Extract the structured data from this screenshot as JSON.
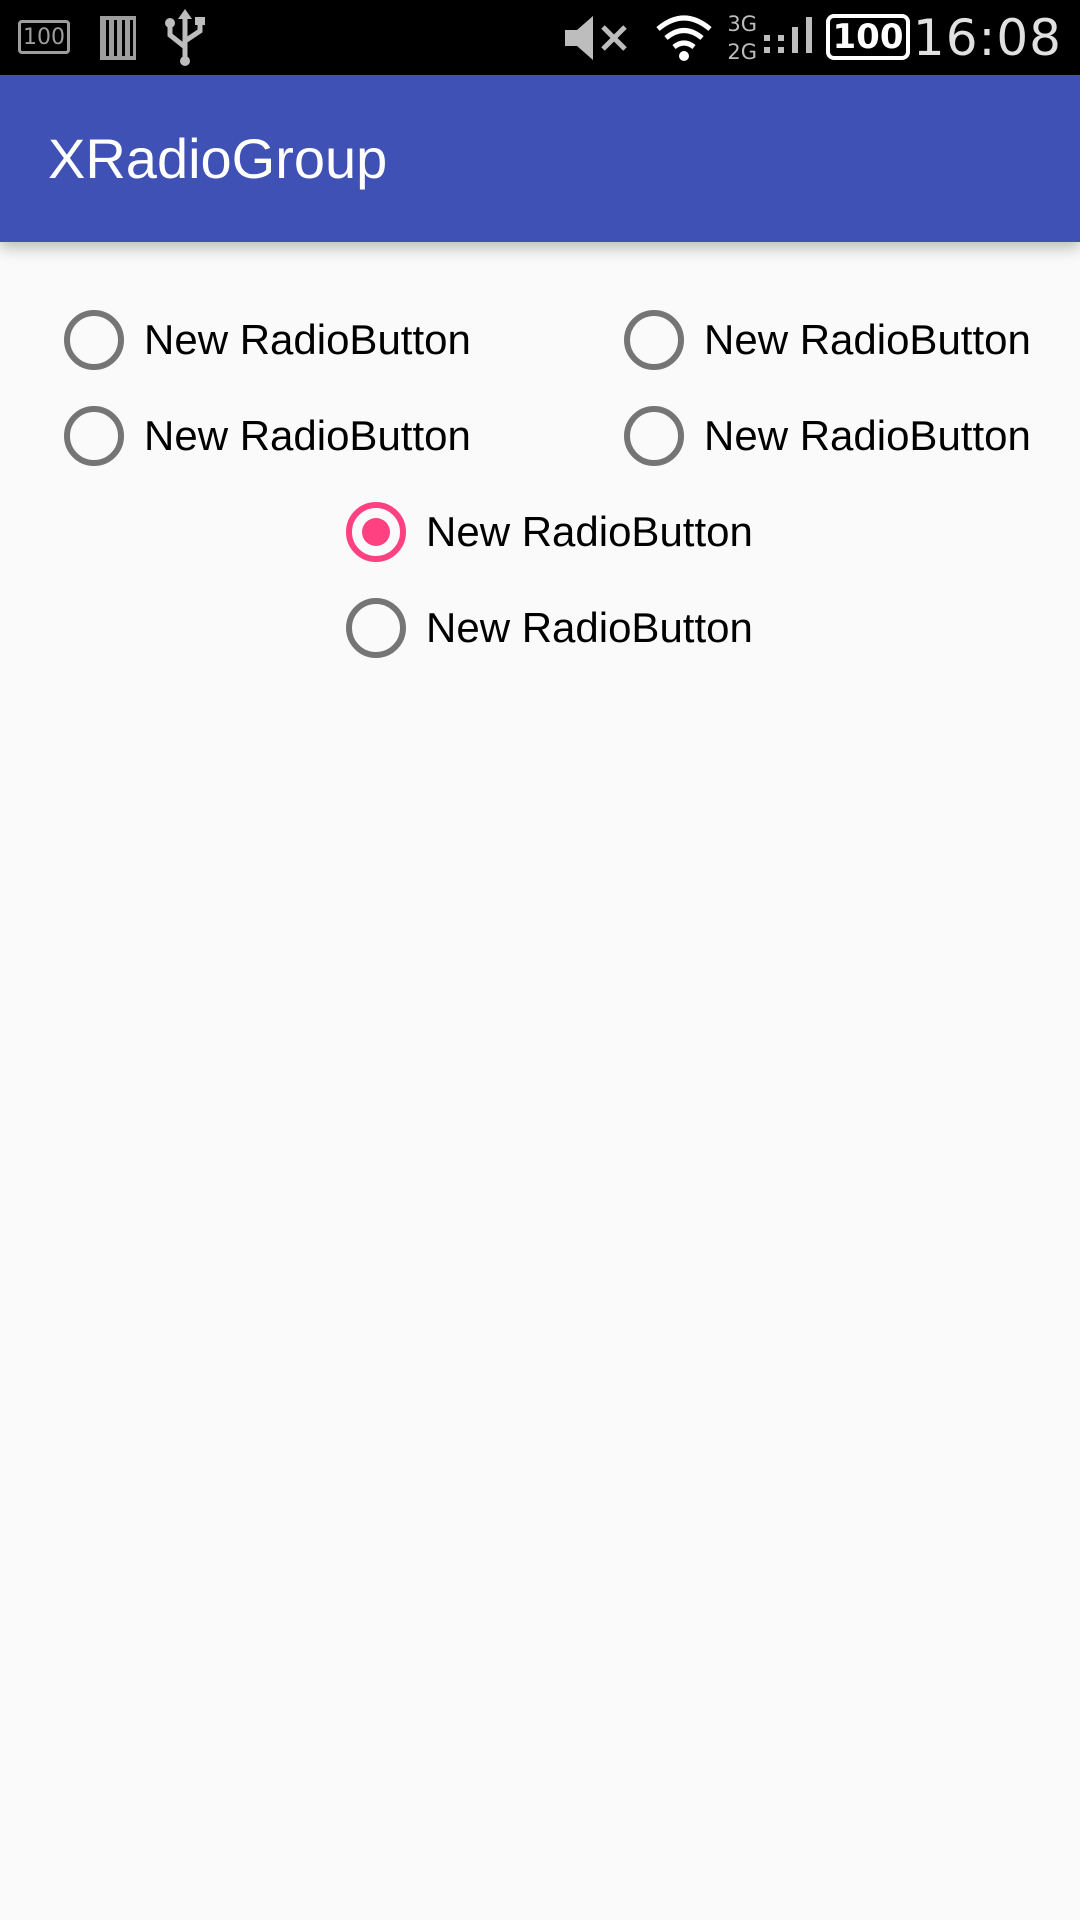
{
  "status_bar": {
    "left_battery": "100",
    "network": [
      "3G",
      "2G"
    ],
    "battery": "100",
    "time": "16:08"
  },
  "app_bar": {
    "title": "XRadioGroup",
    "color": "#3f51b5"
  },
  "radios": [
    {
      "label": "New RadioButton",
      "checked": false
    },
    {
      "label": "New RadioButton",
      "checked": false
    },
    {
      "label": "New RadioButton",
      "checked": false
    },
    {
      "label": "New RadioButton",
      "checked": false
    },
    {
      "label": "New RadioButton",
      "checked": true
    },
    {
      "label": "New RadioButton",
      "checked": false
    }
  ],
  "colors": {
    "accent": "#ff4081",
    "radio_unchecked": "#757575",
    "background": "#fafafa"
  }
}
